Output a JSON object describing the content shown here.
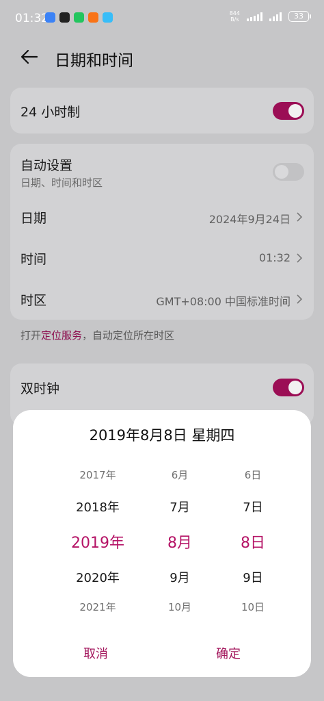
{
  "status": {
    "time": "01:32",
    "net_speed_value": "844",
    "net_speed_unit": "B/s",
    "battery": "33"
  },
  "header": {
    "title": "日期和时间"
  },
  "card1": {
    "hour24_label": "24 小时制",
    "hour24_on": true
  },
  "card2": {
    "auto_label": "自动设置",
    "auto_sub": "日期、时间和时区",
    "auto_on": false,
    "date_label": "日期",
    "date_value": "2024年9月24日",
    "time_label": "时间",
    "time_value": "01:32",
    "tz_label": "时区",
    "tz_value": "GMT+08:00 中国标准时间"
  },
  "hint": {
    "prefix": "打开",
    "link": "定位服务",
    "suffix": "，自动定位所在时区"
  },
  "card3": {
    "dual_label": "双时钟",
    "dual_on": true
  },
  "picker": {
    "title": "2019年8月8日 星期四",
    "years": [
      "2017年",
      "2018年",
      "2019年",
      "2020年",
      "2021年"
    ],
    "months": [
      "6月",
      "7月",
      "8月",
      "9月",
      "10月"
    ],
    "days": [
      "6日",
      "7日",
      "8日",
      "9日",
      "10日"
    ],
    "cancel": "取消",
    "confirm": "确定"
  },
  "colors": {
    "accent": "#9b0e55",
    "accent_text": "#b51366"
  }
}
